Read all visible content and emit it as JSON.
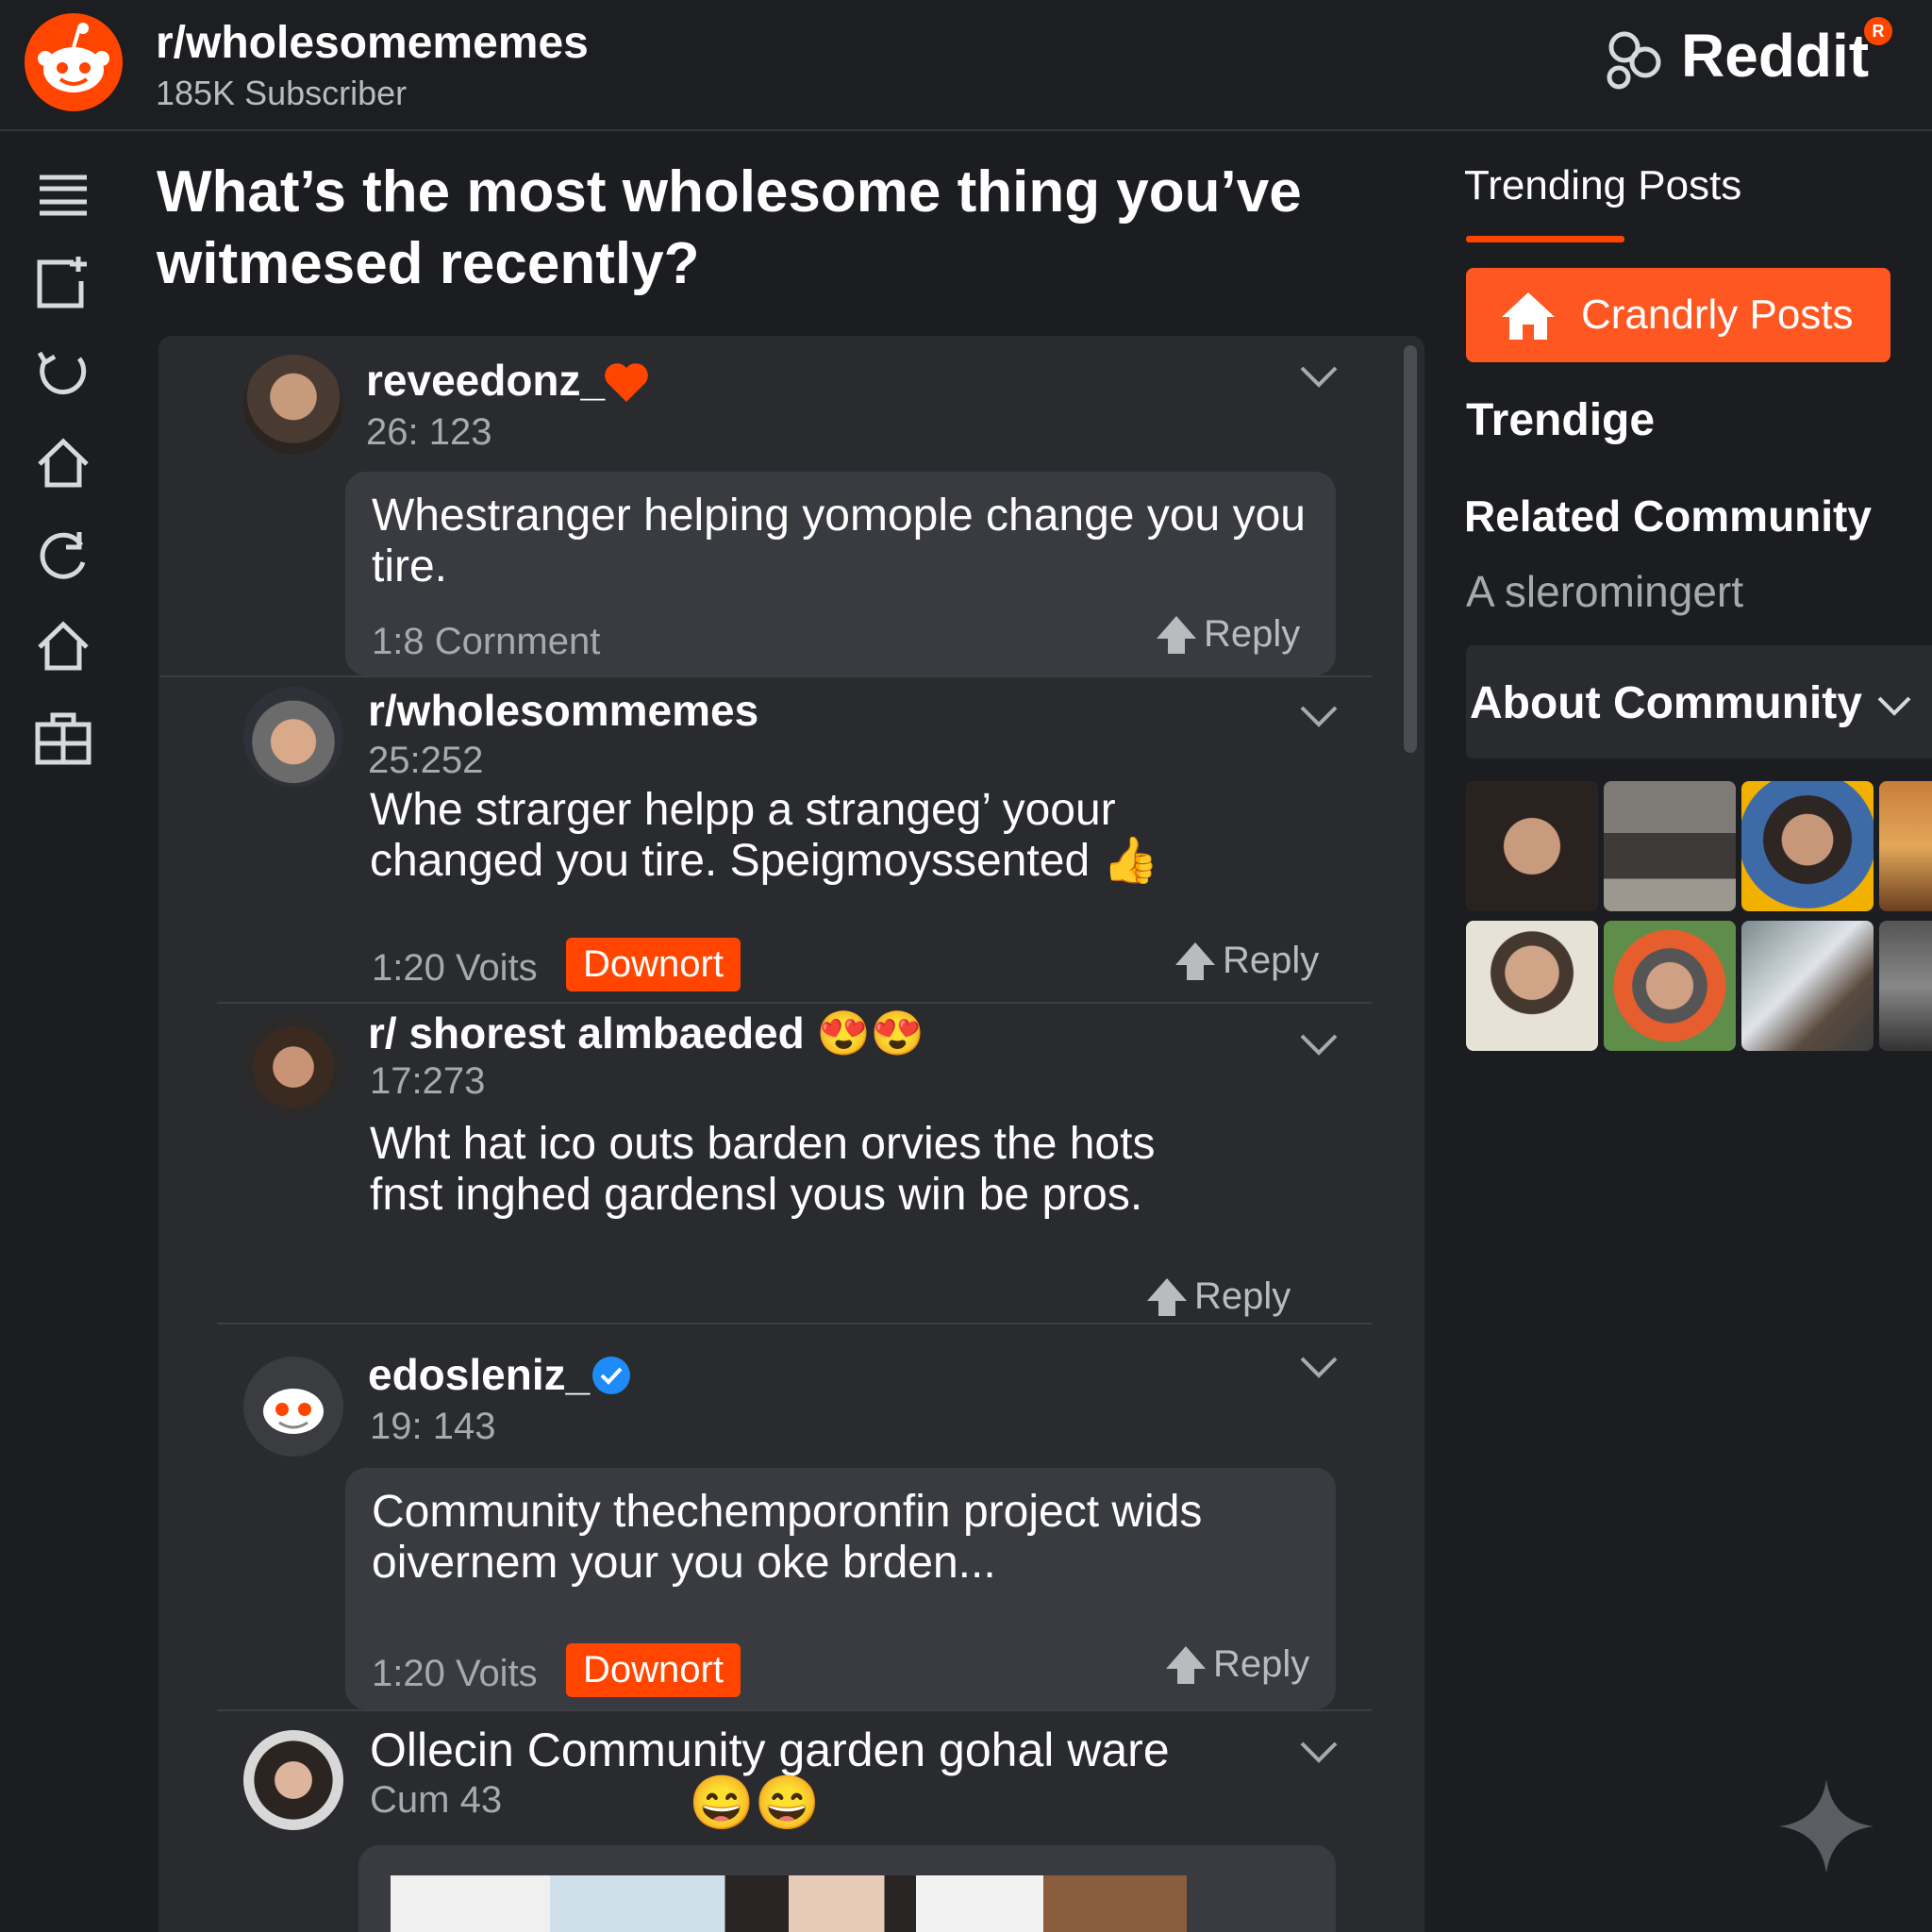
{
  "header": {
    "subreddit": "r/wholesomememes",
    "subscribers": "185K Subscriber",
    "brand": "Reddit",
    "brand_badge": "R"
  },
  "rail_icons": [
    "menu-icon",
    "compose-icon",
    "refresh-icon",
    "home-icon",
    "reload-icon",
    "home-outline-icon",
    "community-icon"
  ],
  "post": {
    "title": "What’s the most wholesome thing you’ve witmesed recently?"
  },
  "comments": [
    {
      "username": "reveedonz_",
      "badge": "heart-icon",
      "meta": "26: 123",
      "text": "Whestranger helping yomople change you you tire.",
      "footer": "1:8 Cornment",
      "reply": "Reply"
    },
    {
      "username": "r/wholesommemes",
      "meta": "25:252",
      "text": "Whe strarger helpp a strangeg’ yoour changed you tire.  Speigmoyssented",
      "emoji": "👍",
      "votes": "1:20 Voits",
      "tag": "Downort",
      "reply": "Reply"
    },
    {
      "username": "r/ shorest almbaeded",
      "emoji": "😍😍",
      "meta": "17:273",
      "text": "Wht hat ico outs barden orvies the hots fnst inghed gardensl yous win be pros.",
      "reply": "Reply"
    },
    {
      "username": "edosleniz_",
      "badge": "verified-icon",
      "meta": "19: 143",
      "text": "Community thechemporonfin project wids oivernem your you oke brden...",
      "votes": "1:20 Voits",
      "tag": "Downort",
      "reply": "Reply"
    },
    {
      "username": "Ollecin Community garden gohal ware",
      "meta": "Cum 43",
      "emoji": "😄😄"
    }
  ],
  "sidebar": {
    "trending_title": "Trending Posts",
    "trending_button": "Crandrly Posts",
    "trendige": "Trendige",
    "related_title": "Related Community",
    "related_sub": "A sleromingert",
    "about": "About Community"
  },
  "colors": {
    "accent": "#ff4500",
    "background": "#1c1d20",
    "panel": "#2a2b2f",
    "bubble": "#393b40"
  }
}
